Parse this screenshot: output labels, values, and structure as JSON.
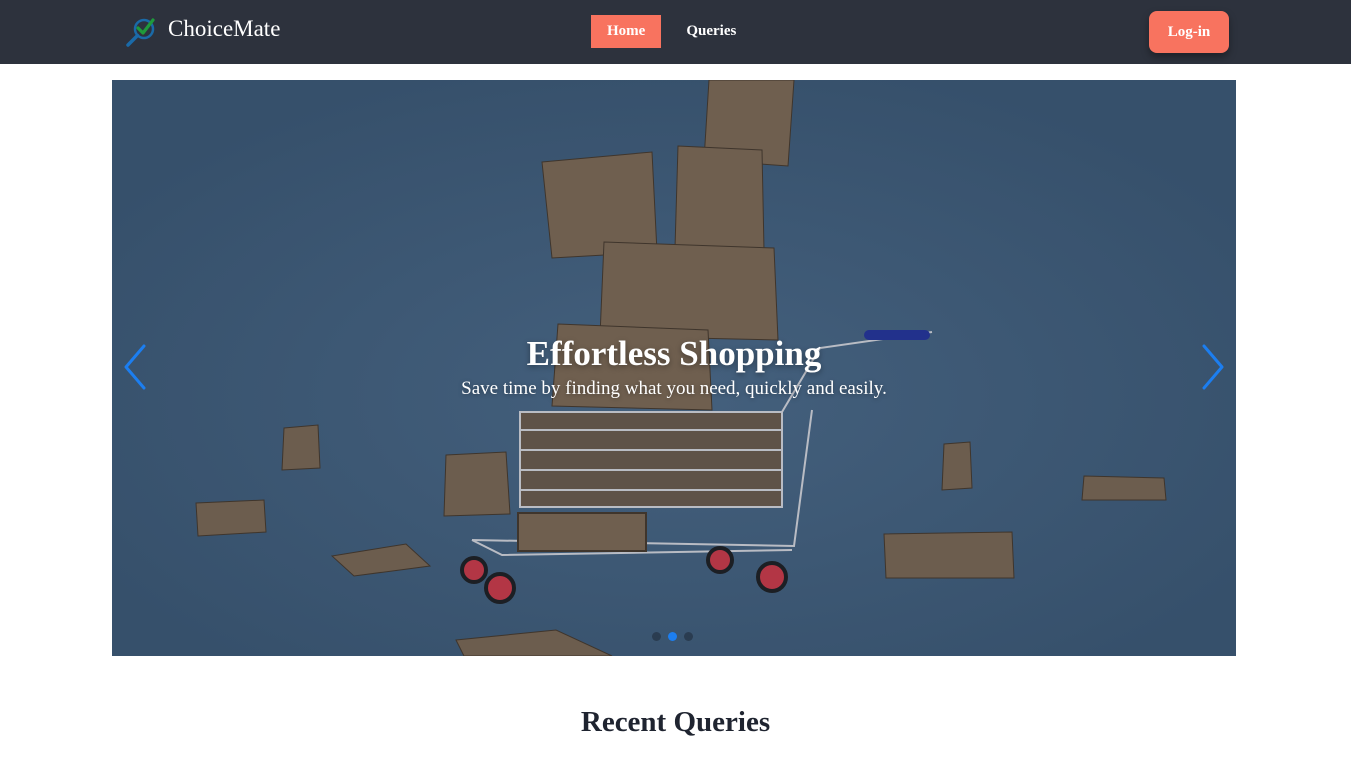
{
  "navbar": {
    "brand": {
      "name": "ChoiceMate",
      "logo_icon": "checkmark-magnifier-logo"
    },
    "links": [
      {
        "label": "Home",
        "active": true
      },
      {
        "label": "Queries",
        "active": false
      }
    ],
    "login_label": "Log-in"
  },
  "hero": {
    "title": "Effortless Shopping",
    "subtitle": "Save time by finding what you need, quickly and easily.",
    "prev_icon": "chevron-left-icon",
    "next_icon": "chevron-right-icon",
    "slide_count": 3,
    "active_slide": 2
  },
  "recent": {
    "title": "Recent Queries"
  },
  "colors": {
    "navbar_bg": "#2d323d",
    "accent": "#f8735f",
    "hero_bg": "#3c5570",
    "arrow": "#1c7ef0"
  }
}
